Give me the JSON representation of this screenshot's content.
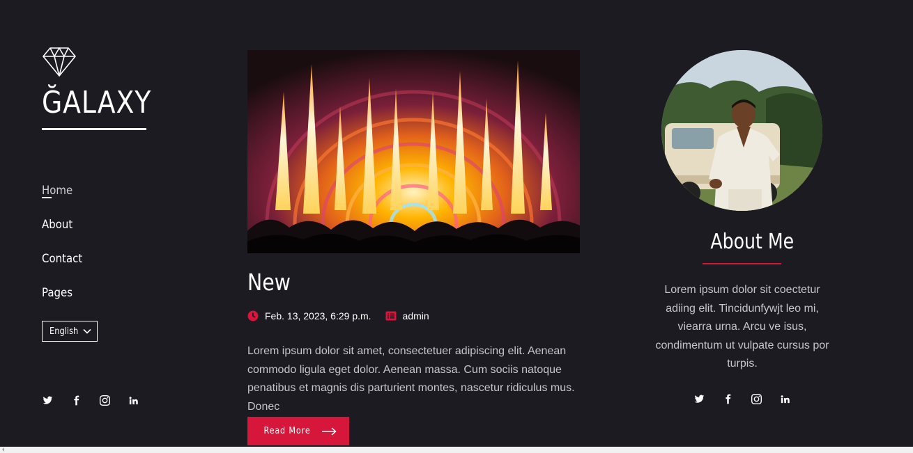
{
  "brand": {
    "name": "ĞALAXY",
    "icon": "diamond-icon"
  },
  "nav": {
    "items": [
      {
        "label": "Home",
        "active": true
      },
      {
        "label": "About",
        "active": false
      },
      {
        "label": "Contact",
        "active": false
      },
      {
        "label": "Pages",
        "active": false
      }
    ],
    "language": {
      "selected": "English"
    }
  },
  "social_icons": [
    "twitter-icon",
    "facebook-icon",
    "instagram-icon",
    "linkedin-icon"
  ],
  "post": {
    "title": "New",
    "date": "Feb. 13, 2023, 6:29 p.m.",
    "author": "admin",
    "excerpt": "Lorem ipsum dolor sit amet, consectetuer adipiscing elit. Aenean commodo ligula eget dolor. Aenean massa. Cum sociis natoque penatibus et magnis dis parturient montes, nascetur ridiculus mus. Donec",
    "read_more": "Read More",
    "image": "concert-stage-with-flames"
  },
  "about": {
    "title": "About Me",
    "text": "Lorem ipsum dolor sit coectetur adiing elit. Tincidunfywjt leo mi, viearra urna. Arcu ve isus, condimentum ut vulpate cursus por turpis.",
    "avatar": "man-by-vintage-car"
  },
  "colors": {
    "background": "#1c1b22",
    "accent": "#d6163a",
    "text": "#ffffff",
    "muted_text": "#c6c5cc"
  }
}
